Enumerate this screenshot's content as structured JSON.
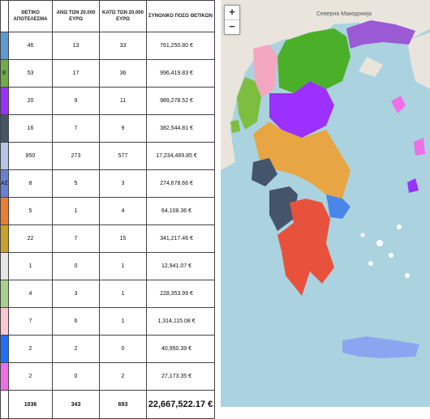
{
  "table": {
    "headers": [
      "ΘΕΤΙΚΟ ΑΠΟΤΕΛΕΣΜΑ",
      "ΑΝΩ ΤΩΝ 20.000 ΕΥΡΩ",
      "ΚΑΤΩ ΤΩΝ 20.000 ΕΥΡΩ",
      "ΣΥΝΟΛΙΚΟ ΠΟΣΟ ΘΕΤΙΚΩΝ"
    ],
    "rows": [
      {
        "color": "#5b9bd5",
        "tag": "",
        "positive": "46",
        "above": "13",
        "below": "33",
        "amount": "761,250.80 €"
      },
      {
        "color": "#70ad47",
        "tag": "E",
        "positive": "53",
        "above": "17",
        "below": "36",
        "amount": "996,419.83 €"
      },
      {
        "color": "#9b30ff",
        "tag": "",
        "positive": "20",
        "above": "9",
        "below": "11",
        "amount": "989,278.52 €"
      },
      {
        "color": "#44546a",
        "tag": "",
        "positive": "16",
        "above": "7",
        "below": "9",
        "amount": "382,544.81 €"
      },
      {
        "color": "#b4c7e7",
        "tag": "",
        "positive": "850",
        "above": "273",
        "below": "577",
        "amount": "17,234,489.85 €"
      },
      {
        "color": "#6b7fd7",
        "tag": "ΑΣ",
        "positive": "8",
        "above": "5",
        "below": "3",
        "amount": "274,678.66 €"
      },
      {
        "color": "#ed7d31",
        "tag": "",
        "positive": "5",
        "above": "1",
        "below": "4",
        "amount": "64,108.36 €"
      },
      {
        "color": "#c9a227",
        "tag": "",
        "positive": "22",
        "above": "7",
        "below": "15",
        "amount": "341,217.46 €"
      },
      {
        "color": "#e7e6e6",
        "tag": "",
        "positive": "1",
        "above": "0",
        "below": "1",
        "amount": "12,941.07 €"
      },
      {
        "color": "#a9d18e",
        "tag": "",
        "positive": "4",
        "above": "3",
        "below": "1",
        "amount": "228,353.99 €"
      },
      {
        "color": "#f8c8d4",
        "tag": "",
        "positive": "7",
        "above": "6",
        "below": "1",
        "amount": "1,314,115.08 €"
      },
      {
        "color": "#1f6fff",
        "tag": "",
        "positive": "2",
        "above": "2",
        "below": "0",
        "amount": "40,950.39 €"
      },
      {
        "color": "#ee6fe8",
        "tag": "",
        "positive": "2",
        "above": "0",
        "below": "2",
        "amount": "27,173.35 €"
      }
    ],
    "total": {
      "positive": "1036",
      "above": "343",
      "below": "693",
      "amount": "22,667,522.17 €"
    }
  },
  "map": {
    "zoom_in": "+",
    "zoom_out": "−",
    "labels": {
      "country": "Северна Македонија"
    }
  }
}
